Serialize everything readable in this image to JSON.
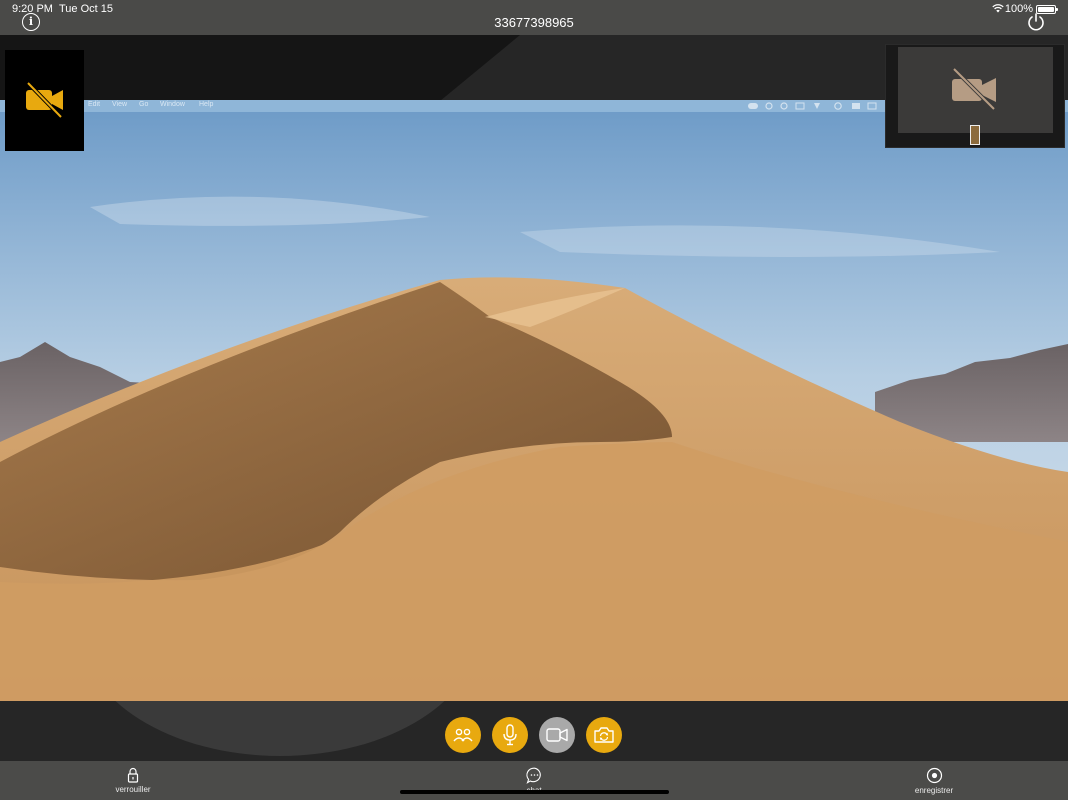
{
  "status_bar": {
    "time": "9:20 PM",
    "date": "Tue Oct 15",
    "battery_percent": "100%"
  },
  "header": {
    "title": "33677398965"
  },
  "remote_menubar": {
    "items": [
      "Edit",
      "View",
      "Go",
      "Window",
      "Help"
    ]
  },
  "controls": [
    {
      "name": "participants-button",
      "icon": "participants-icon",
      "state": "active"
    },
    {
      "name": "microphone-button",
      "icon": "microphone-icon",
      "state": "active"
    },
    {
      "name": "camera-button",
      "icon": "video-camera-icon",
      "state": "disabled"
    },
    {
      "name": "switch-camera-button",
      "icon": "switch-camera-icon",
      "state": "active"
    }
  ],
  "tabbar": {
    "lock_label": "verrouiller",
    "chat_label": "chat",
    "record_label": "enregistrer"
  },
  "colors": {
    "accent": "#e8a90f",
    "disabled": "#a9a9a9",
    "bar": "#4b4b49"
  }
}
